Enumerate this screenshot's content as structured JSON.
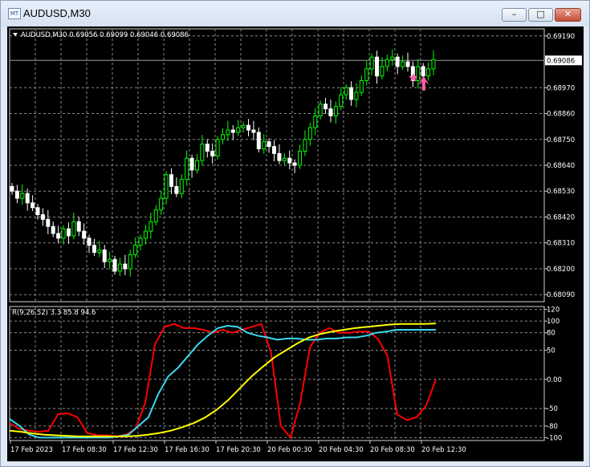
{
  "window": {
    "title": "AUDUSD,M30",
    "min_label": "–",
    "max_label": "□",
    "close_label": "✕",
    "app_icon_label": "MT"
  },
  "colors": {
    "background": "#000000",
    "grid": "#8a8a8a",
    "bull_candle": "#00ff00",
    "bear_candle": "#ffffff",
    "rsi_line": "#ff0000",
    "cyan_line": "#3ad8f0",
    "yellow_line": "#ffff00",
    "signal": "#ff5fa8"
  },
  "chart_data": [
    {
      "type": "candlestick",
      "symbol_label": "AUDUSD,M30",
      "ohlc_label": "0.69056 0.69099 0.69046 0.69086",
      "ylim": [
        0.6806,
        0.6922
      ],
      "y_ticks": [
        "0.69190",
        "0.69086",
        "0.68970",
        "0.68860",
        "0.68750",
        "0.68640",
        "0.68530",
        "0.68420",
        "0.68310",
        "0.68200",
        "0.68090"
      ],
      "current_price": "0.69086",
      "grid": true,
      "closes": [
        0.6853,
        0.685,
        0.6852,
        0.6848,
        0.6846,
        0.6843,
        0.6841,
        0.6838,
        0.6835,
        0.6833,
        0.6837,
        0.6834,
        0.684,
        0.6836,
        0.6833,
        0.683,
        0.6827,
        0.6828,
        0.6823,
        0.6824,
        0.6819,
        0.6822,
        0.682,
        0.6826,
        0.683,
        0.6833,
        0.6836,
        0.684,
        0.6845,
        0.685,
        0.686,
        0.6855,
        0.6852,
        0.6858,
        0.6867,
        0.6862,
        0.6866,
        0.6873,
        0.687,
        0.6868,
        0.6875,
        0.6877,
        0.6879,
        0.6878,
        0.688,
        0.6881,
        0.6879,
        0.6878,
        0.6871,
        0.6874,
        0.6872,
        0.6869,
        0.6866,
        0.6867,
        0.6865,
        0.6864,
        0.687,
        0.6875,
        0.688,
        0.6885,
        0.689,
        0.6888,
        0.6885,
        0.6889,
        0.6894,
        0.6897,
        0.6892,
        0.6895,
        0.69,
        0.6905,
        0.691,
        0.6902,
        0.6906,
        0.6909,
        0.691,
        0.6906,
        0.6908,
        0.6906,
        0.69,
        0.6906,
        0.6902,
        0.6905,
        0.6909
      ],
      "signal": {
        "type": "buy-arrow",
        "index": 79
      }
    },
    {
      "type": "line",
      "indicator_label": "R(9,26,52) 3.3 85.8 94.6",
      "ylim": [
        -105,
        125
      ],
      "y_ticks": [
        "120",
        "100",
        "80",
        "50",
        "0.00",
        "-50",
        "-80",
        "-100"
      ],
      "series": [
        {
          "values": [
            -75,
            -85,
            -88,
            -90,
            -88,
            -60,
            -58,
            -65,
            -92,
            -96,
            -96,
            -98,
            -95,
            -85,
            -40,
            60,
            90,
            95,
            88,
            88,
            85,
            80,
            85,
            80,
            85,
            90,
            95,
            45,
            -80,
            -100,
            -40,
            55,
            80,
            88,
            80,
            80,
            82,
            82,
            70,
            40,
            -60,
            -70,
            -65,
            -45,
            0
          ]
        },
        {
          "values": [
            -68,
            -80,
            -95,
            -100,
            -100,
            -100,
            -100,
            -100,
            -100,
            -100,
            -100,
            -98,
            -95,
            -80,
            -65,
            -25,
            5,
            20,
            40,
            60,
            75,
            88,
            92,
            90,
            80,
            75,
            72,
            68,
            70,
            70,
            68,
            68,
            70,
            70,
            72,
            72,
            75,
            80,
            82,
            85,
            85,
            85,
            85,
            85
          ]
        },
        {
          "values": [
            -88,
            -90,
            -93,
            -95,
            -96,
            -97,
            -98,
            -98,
            -98,
            -98,
            -98,
            -97,
            -95,
            -92,
            -88,
            -82,
            -75,
            -65,
            -52,
            -35,
            -15,
            5,
            22,
            38,
            50,
            62,
            72,
            78,
            82,
            85,
            88,
            90,
            92,
            94,
            95,
            95,
            95,
            96
          ]
        }
      ]
    }
  ],
  "x_labels": [
    "17 Feb 2023",
    "17 Feb 08:30",
    "17 Feb 12:30",
    "17 Feb 16:30",
    "17 Feb 20:30",
    "20 Feb 00:30",
    "20 Feb 04:30",
    "20 Feb 08:30",
    "20 Feb 12:30"
  ]
}
